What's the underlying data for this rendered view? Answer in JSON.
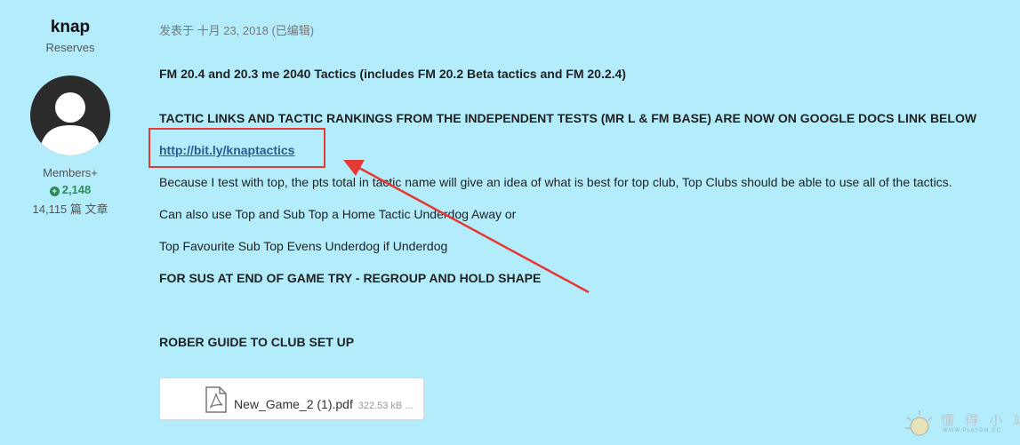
{
  "author": {
    "name": "knap",
    "group": "Reserves",
    "rank": "Members+",
    "reputation": "2,148",
    "posts": "14,115 篇 文章"
  },
  "post": {
    "meta": "发表于 十月 23, 2018 (已编辑)",
    "title": "FM 20.4 and 20.3 me 2040  Tactics  (includes FM 20.2 Beta tactics and FM 20.2.4)",
    "notice": "TACTIC LINKS AND TACTIC RANKINGS FROM THE INDEPENDENT TESTS (MR L & FM BASE) ARE NOW ON GOOGLE DOCS LINK BELOW",
    "link": "http://bit.ly/knaptactics",
    "para1": "Because I test with top, the pts total in tactic name will give an idea of what is best for top club, Top Clubs should be able to use all of the tactics.",
    "para2": "Can also use Top and Sub Top a Home Tactic Underdog Away or",
    "para3": "Top Favourite Sub Top Evens Underdog if Underdog",
    "para4": "FOR SUS AT END OF GAME TRY - REGROUP AND HOLD SHAPE",
    "para5": "ROBER GUIDE TO CLUB SET UP"
  },
  "attachment": {
    "filename": "New_Game_2 (1).pdf",
    "size": "322.53 kB ..."
  },
  "watermark": {
    "text": "懂 得 小 站",
    "url": "WWW.PLAYDM.CC"
  },
  "colors": {
    "background": "#b3ecfb",
    "link": "#2a5d8f",
    "highlight": "#e53935",
    "reputation": "#2e8b57"
  }
}
